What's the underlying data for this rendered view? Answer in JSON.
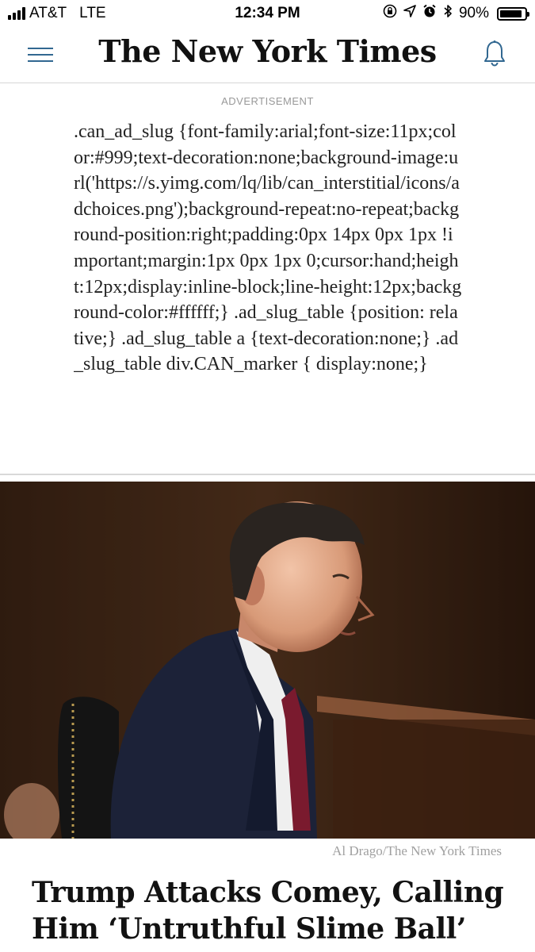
{
  "status_bar": {
    "carrier": "AT&T",
    "network": "LTE",
    "time": "12:34 PM",
    "battery": "90%",
    "battery_level": 0.9,
    "icons": [
      "orientation-lock-icon",
      "location-icon",
      "alarm-icon",
      "bluetooth-icon"
    ]
  },
  "header": {
    "logo": "The New York Times",
    "menu_icon": "hamburger-menu-icon",
    "notification_icon": "bell-icon",
    "accent_color": "#326891"
  },
  "ad": {
    "label": "ADVERTISEMENT",
    "code_text": ".can_ad_slug {font-family:arial;font-size:11px;color:#999;text-decoration:none;background-image:url('https://s.yimg.com/lq/lib/can_interstitial/icons/adchoices.png');background-repeat:no-repeat;background-position:right;padding:0px 14px 0px 1px !important;margin:1px 0px 1px 0;cursor:hand;height:12px;display:inline-block;line-height:12px;background-color:#ffffff;} .ad_slug_table {position: relative;} .ad_slug_table a {text-decoration:none;} .ad_slug_table div.CAN_marker { display:none;}"
  },
  "article": {
    "photo_credit": "Al Drago/The New York Times",
    "headline": "Trump Attacks Comey, Calling Him ‘Untruthful Slime Ball’"
  }
}
